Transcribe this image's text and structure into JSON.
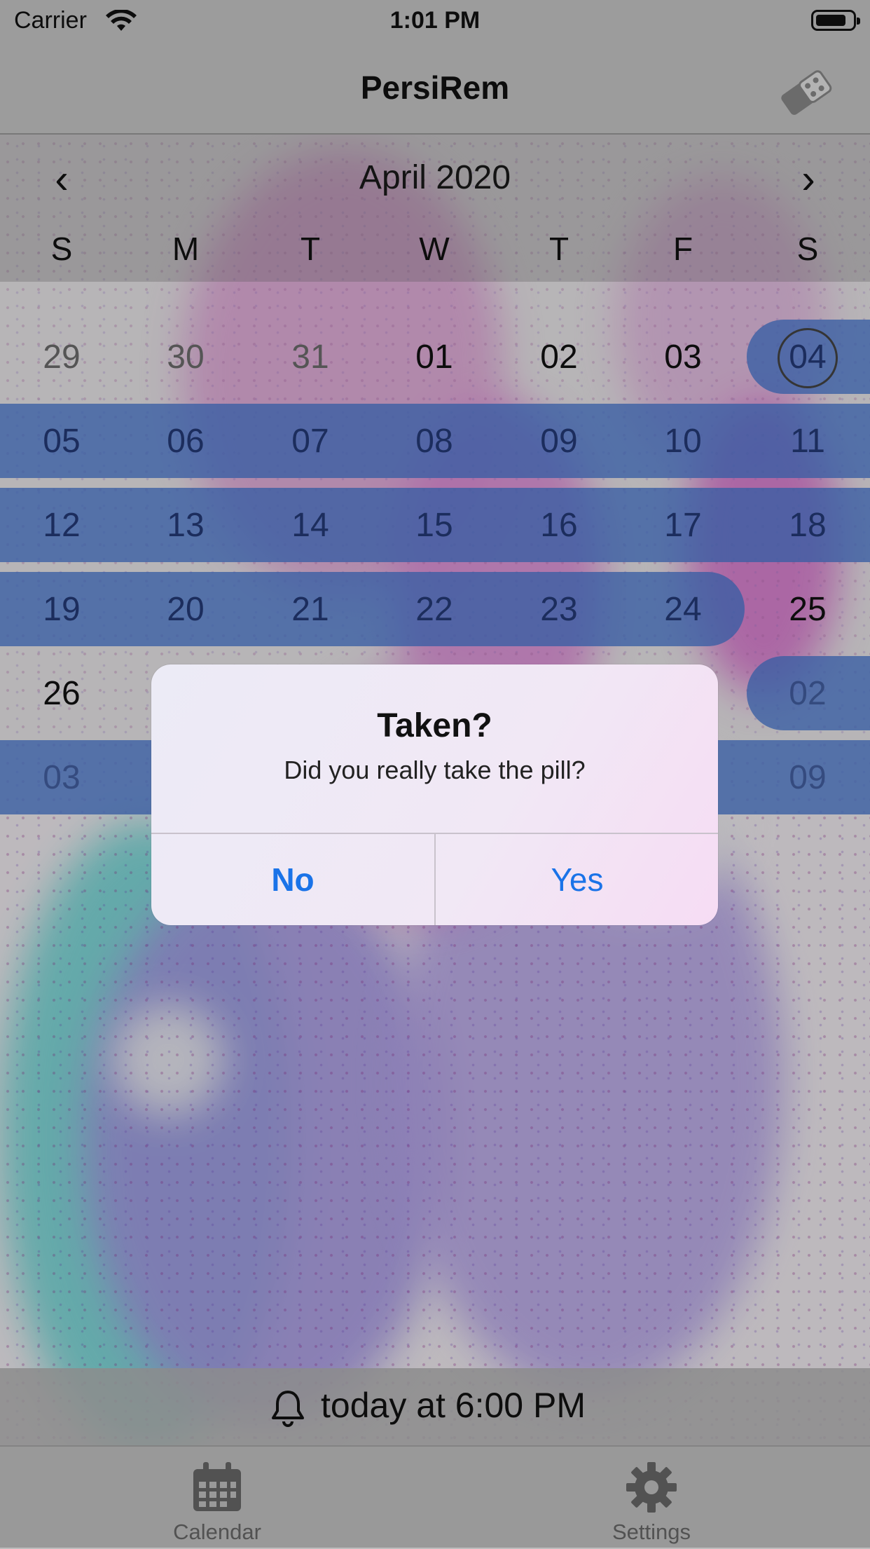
{
  "status_bar": {
    "carrier": "Carrier",
    "time": "1:01 PM"
  },
  "nav": {
    "title": "PersiRem",
    "pill_icon": "pill-pack-icon"
  },
  "calendar": {
    "month_label": "April  2020",
    "prev_glyph": "‹",
    "next_glyph": "›",
    "weekdays": [
      "S",
      "M",
      "T",
      "W",
      "T",
      "F",
      "S"
    ],
    "weeks": [
      [
        "29",
        "30",
        "31",
        "01",
        "02",
        "03",
        "04"
      ],
      [
        "05",
        "06",
        "07",
        "08",
        "09",
        "10",
        "11"
      ],
      [
        "12",
        "13",
        "14",
        "15",
        "16",
        "17",
        "18"
      ],
      [
        "19",
        "20",
        "21",
        "22",
        "23",
        "24",
        "25"
      ],
      [
        "26",
        "",
        "",
        "",
        "",
        "",
        "02"
      ],
      [
        "03",
        "",
        "",
        "",
        "",
        "",
        "09"
      ]
    ]
  },
  "alert": {
    "title": "Taken?",
    "message": "Did you really take the pill?",
    "no_label": "No",
    "yes_label": "Yes"
  },
  "reminder": {
    "text": "today at 6:00 PM"
  },
  "tabs": [
    {
      "label": "Calendar",
      "icon": "calendar-icon"
    },
    {
      "label": "Settings",
      "icon": "gear-icon"
    }
  ],
  "colors": {
    "accent": "#1a73e8",
    "selection_band": "#4878d2"
  }
}
